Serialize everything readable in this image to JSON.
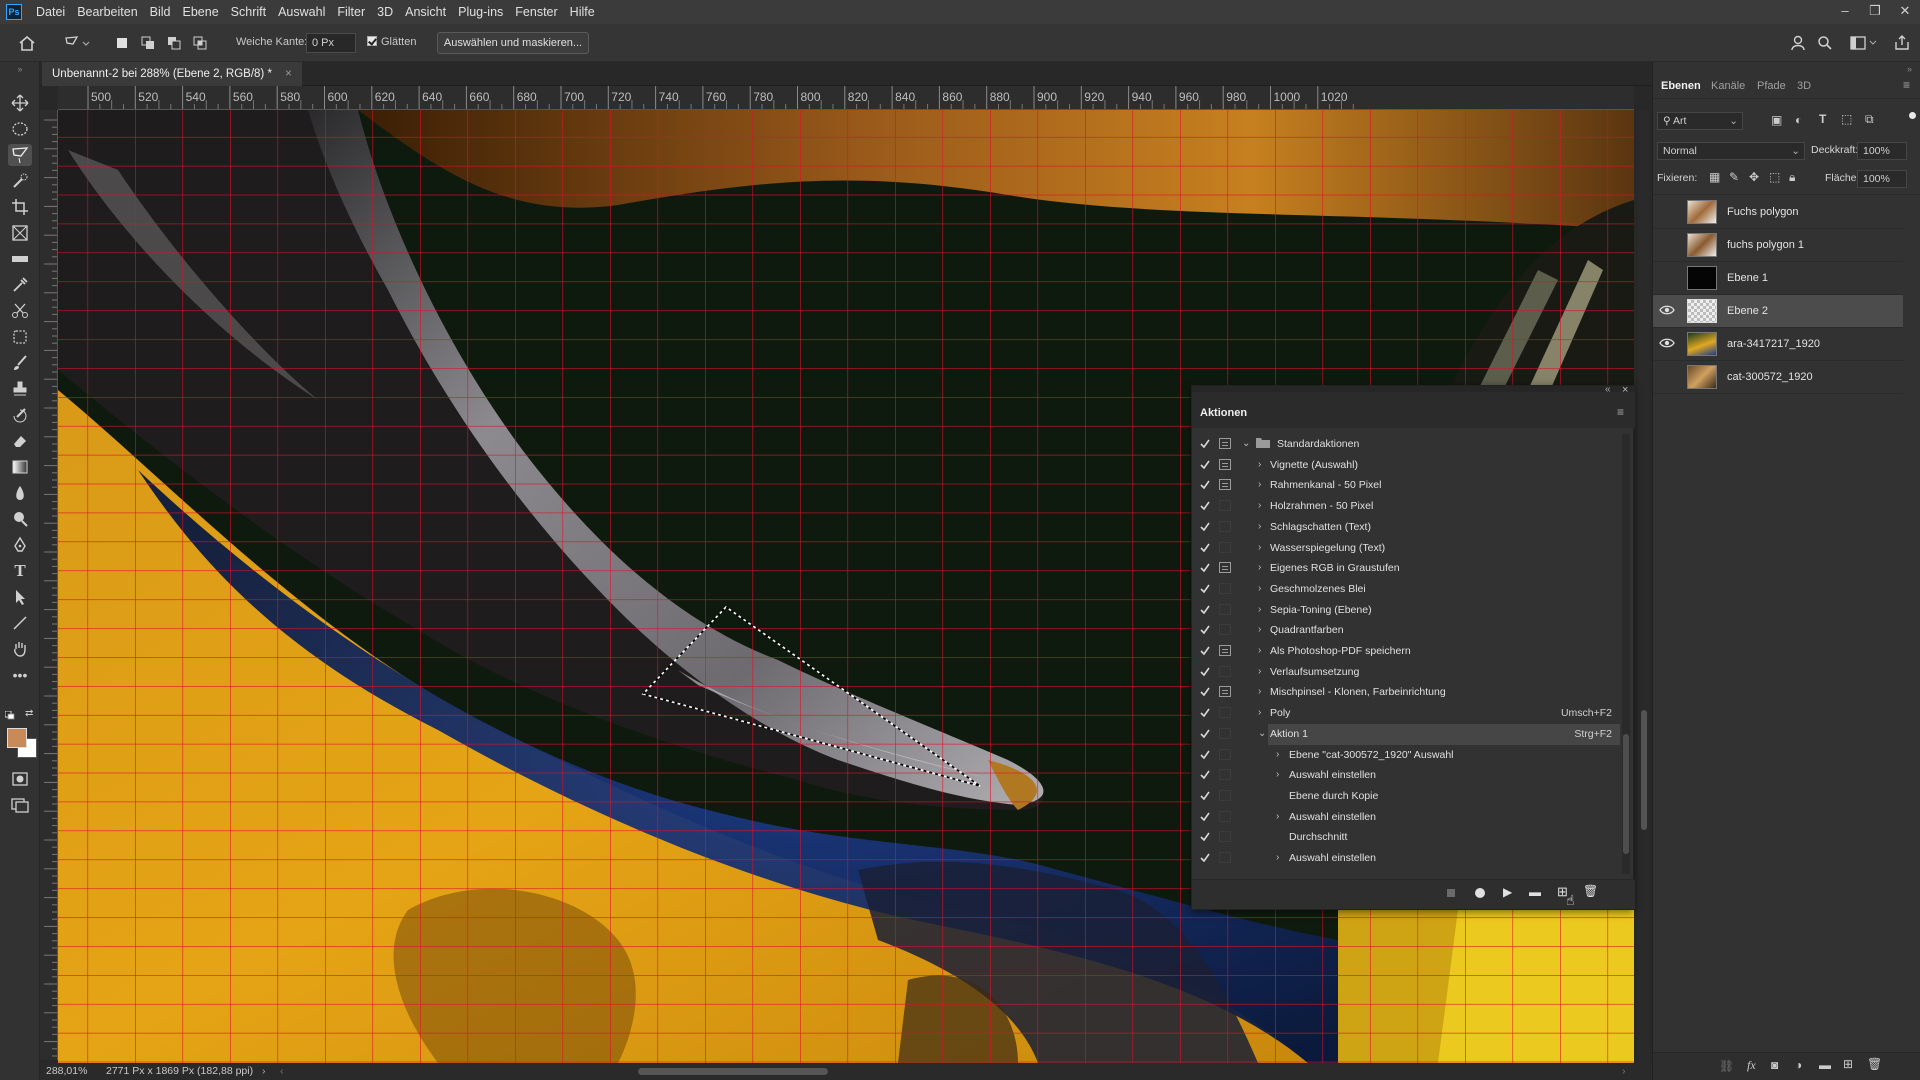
{
  "menubar": {
    "items": [
      "Datei",
      "Bearbeiten",
      "Bild",
      "Ebene",
      "Schrift",
      "Auswahl",
      "Filter",
      "3D",
      "Ansicht",
      "Plug-ins",
      "Fenster",
      "Hilfe"
    ],
    "logo": "Ps"
  },
  "options": {
    "feather_label": "Weiche Kante:",
    "feather_value": "0 Px",
    "antialias_label": "Glätten",
    "select_mask": "Auswählen und maskieren..."
  },
  "document": {
    "tab_title": "Unbenannt-2 bei 288% (Ebene 2, RGB/8) *",
    "zoom": "288,01%",
    "dimensions": "2771 Px x 1869 Px (182,88 ppi)"
  },
  "ruler": {
    "ticks": [
      "500",
      "520",
      "540",
      "560",
      "580",
      "600",
      "620",
      "640",
      "660",
      "680",
      "700",
      "720",
      "740",
      "760",
      "780",
      "800",
      "820",
      "840",
      "860",
      "880",
      "900",
      "920",
      "940",
      "960",
      "980",
      "1000",
      "1020"
    ]
  },
  "layers_panel": {
    "tabs": [
      "Ebenen",
      "Kanäle",
      "Pfade",
      "3D"
    ],
    "filter_label": "Art",
    "blend_mode": "Normal",
    "opacity_label": "Deckkraft:",
    "opacity_value": "100%",
    "lock_label": "Fixieren:",
    "fill_label": "Fläche:",
    "fill_value": "100%",
    "layers": [
      {
        "name": "Fuchs polygon",
        "visible": false,
        "selected": false
      },
      {
        "name": "fuchs polygon 1",
        "visible": false,
        "selected": false
      },
      {
        "name": "Ebene 1",
        "visible": false,
        "selected": false
      },
      {
        "name": "Ebene 2",
        "visible": true,
        "selected": true
      },
      {
        "name": "ara-3417217_1920",
        "visible": true,
        "selected": false
      },
      {
        "name": "cat-300572_1920",
        "visible": false,
        "selected": false
      }
    ]
  },
  "actions_panel": {
    "title": "Aktionen",
    "items": [
      {
        "label": "Standardaktionen",
        "level": 0,
        "set": true,
        "dialog": true,
        "expanded": true,
        "shortcut": ""
      },
      {
        "label": "Vignette (Auswahl)",
        "level": 1,
        "dialog": true,
        "shortcut": ""
      },
      {
        "label": "Rahmenkanal - 50 Pixel",
        "level": 1,
        "dialog": true,
        "shortcut": ""
      },
      {
        "label": "Holzrahmen - 50 Pixel",
        "level": 1,
        "dialog": false,
        "shortcut": ""
      },
      {
        "label": "Schlagschatten (Text)",
        "level": 1,
        "dialog": false,
        "shortcut": ""
      },
      {
        "label": "Wasserspiegelung (Text)",
        "level": 1,
        "dialog": false,
        "shortcut": ""
      },
      {
        "label": "Eigenes RGB in Graustufen",
        "level": 1,
        "dialog": true,
        "shortcut": ""
      },
      {
        "label": "Geschmolzenes Blei",
        "level": 1,
        "dialog": false,
        "shortcut": ""
      },
      {
        "label": "Sepia-Toning (Ebene)",
        "level": 1,
        "dialog": false,
        "shortcut": ""
      },
      {
        "label": "Quadrantfarben",
        "level": 1,
        "dialog": false,
        "shortcut": ""
      },
      {
        "label": "Als Photoshop-PDF speichern",
        "level": 1,
        "dialog": true,
        "shortcut": ""
      },
      {
        "label": "Verlaufsumsetzung",
        "level": 1,
        "dialog": false,
        "shortcut": ""
      },
      {
        "label": "Mischpinsel - Klonen, Farbeinrichtung",
        "level": 1,
        "dialog": true,
        "shortcut": ""
      },
      {
        "label": "Poly",
        "level": 1,
        "dialog": false,
        "shortcut": "Umsch+F2"
      },
      {
        "label": "Aktion 1",
        "level": 1,
        "dialog": false,
        "expanded": true,
        "selected": true,
        "shortcut": "Strg+F2"
      },
      {
        "label": "Ebene \"cat-300572_1920\" Auswahl",
        "level": 2,
        "dialog": false,
        "shortcut": ""
      },
      {
        "label": "Auswahl einstellen",
        "level": 2,
        "dialog": false,
        "shortcut": ""
      },
      {
        "label": "Ebene durch Kopie",
        "level": 2,
        "dialog": false,
        "noexpand": true,
        "shortcut": ""
      },
      {
        "label": "Auswahl einstellen",
        "level": 2,
        "dialog": false,
        "shortcut": ""
      },
      {
        "label": "Durchschnitt",
        "level": 2,
        "dialog": false,
        "noexpand": true,
        "shortcut": ""
      },
      {
        "label": "Auswahl einstellen",
        "level": 2,
        "dialog": false,
        "shortcut": ""
      }
    ]
  },
  "colors": {
    "grid": "#e0102a",
    "foreground": "#c98a5a",
    "background": "#ffffff",
    "accent": "#31a8ff"
  }
}
